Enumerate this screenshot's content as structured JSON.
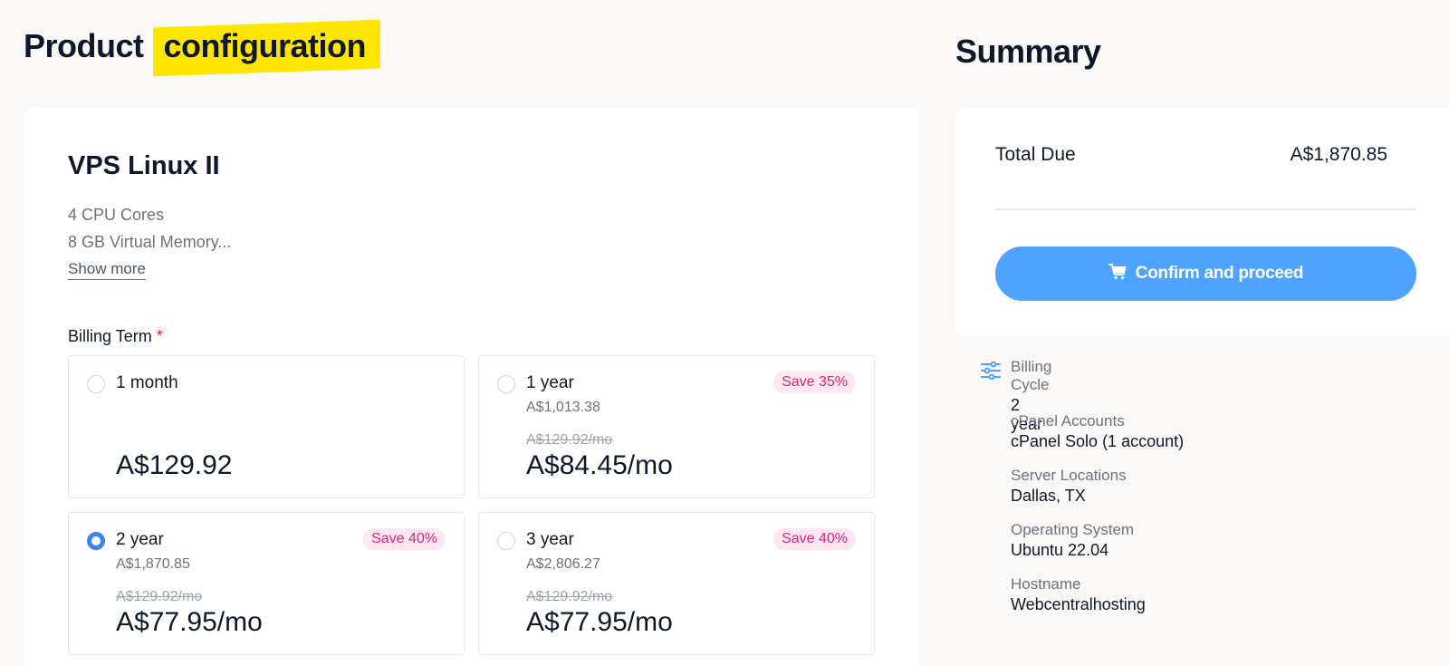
{
  "header": {
    "title_part1": "Product",
    "title_part2": "configuration",
    "summary_title": "Summary"
  },
  "product": {
    "name": "VPS Linux II",
    "features": [
      "4 CPU Cores",
      "8 GB Virtual Memory..."
    ],
    "show_more": "Show more"
  },
  "billing": {
    "label": "Billing Term",
    "required_mark": "*",
    "options": [
      {
        "term": "1 month",
        "badge": "",
        "total": "",
        "old_price": "",
        "price": "A$129.92",
        "selected": false
      },
      {
        "term": "1 year",
        "badge": "Save 35%",
        "total": "A$1,013.38",
        "old_price": "A$129.92/mo",
        "price": "A$84.45/mo",
        "selected": false
      },
      {
        "term": "2 year",
        "badge": "Save 40%",
        "total": "A$1,870.85",
        "old_price": "A$129.92/mo",
        "price": "A$77.95/mo",
        "selected": true
      },
      {
        "term": "3 year",
        "badge": "Save 40%",
        "total": "A$2,806.27",
        "old_price": "A$129.92/mo",
        "price": "A$77.95/mo",
        "selected": false
      }
    ]
  },
  "summary": {
    "total_due_label": "Total Due",
    "total_due_value": "A$1,870.85",
    "confirm_button": "Confirm and proceed",
    "details": [
      {
        "label": "Billing Cycle",
        "value": "2 year"
      },
      {
        "label": "cPanel Accounts",
        "value": "cPanel Solo (1 account)"
      },
      {
        "label": "Server Locations",
        "value": "Dallas, TX"
      },
      {
        "label": "Operating System",
        "value": "Ubuntu 22.04"
      },
      {
        "label": "Hostname",
        "value": "Webcentralhosting"
      }
    ]
  },
  "colors": {
    "accent": "#4da3ff",
    "highlight": "#ffe600",
    "badge_text": "#db2777",
    "badge_bg": "#fce7f3"
  },
  "icons": [
    "cart-icon",
    "sliders-icon"
  ]
}
